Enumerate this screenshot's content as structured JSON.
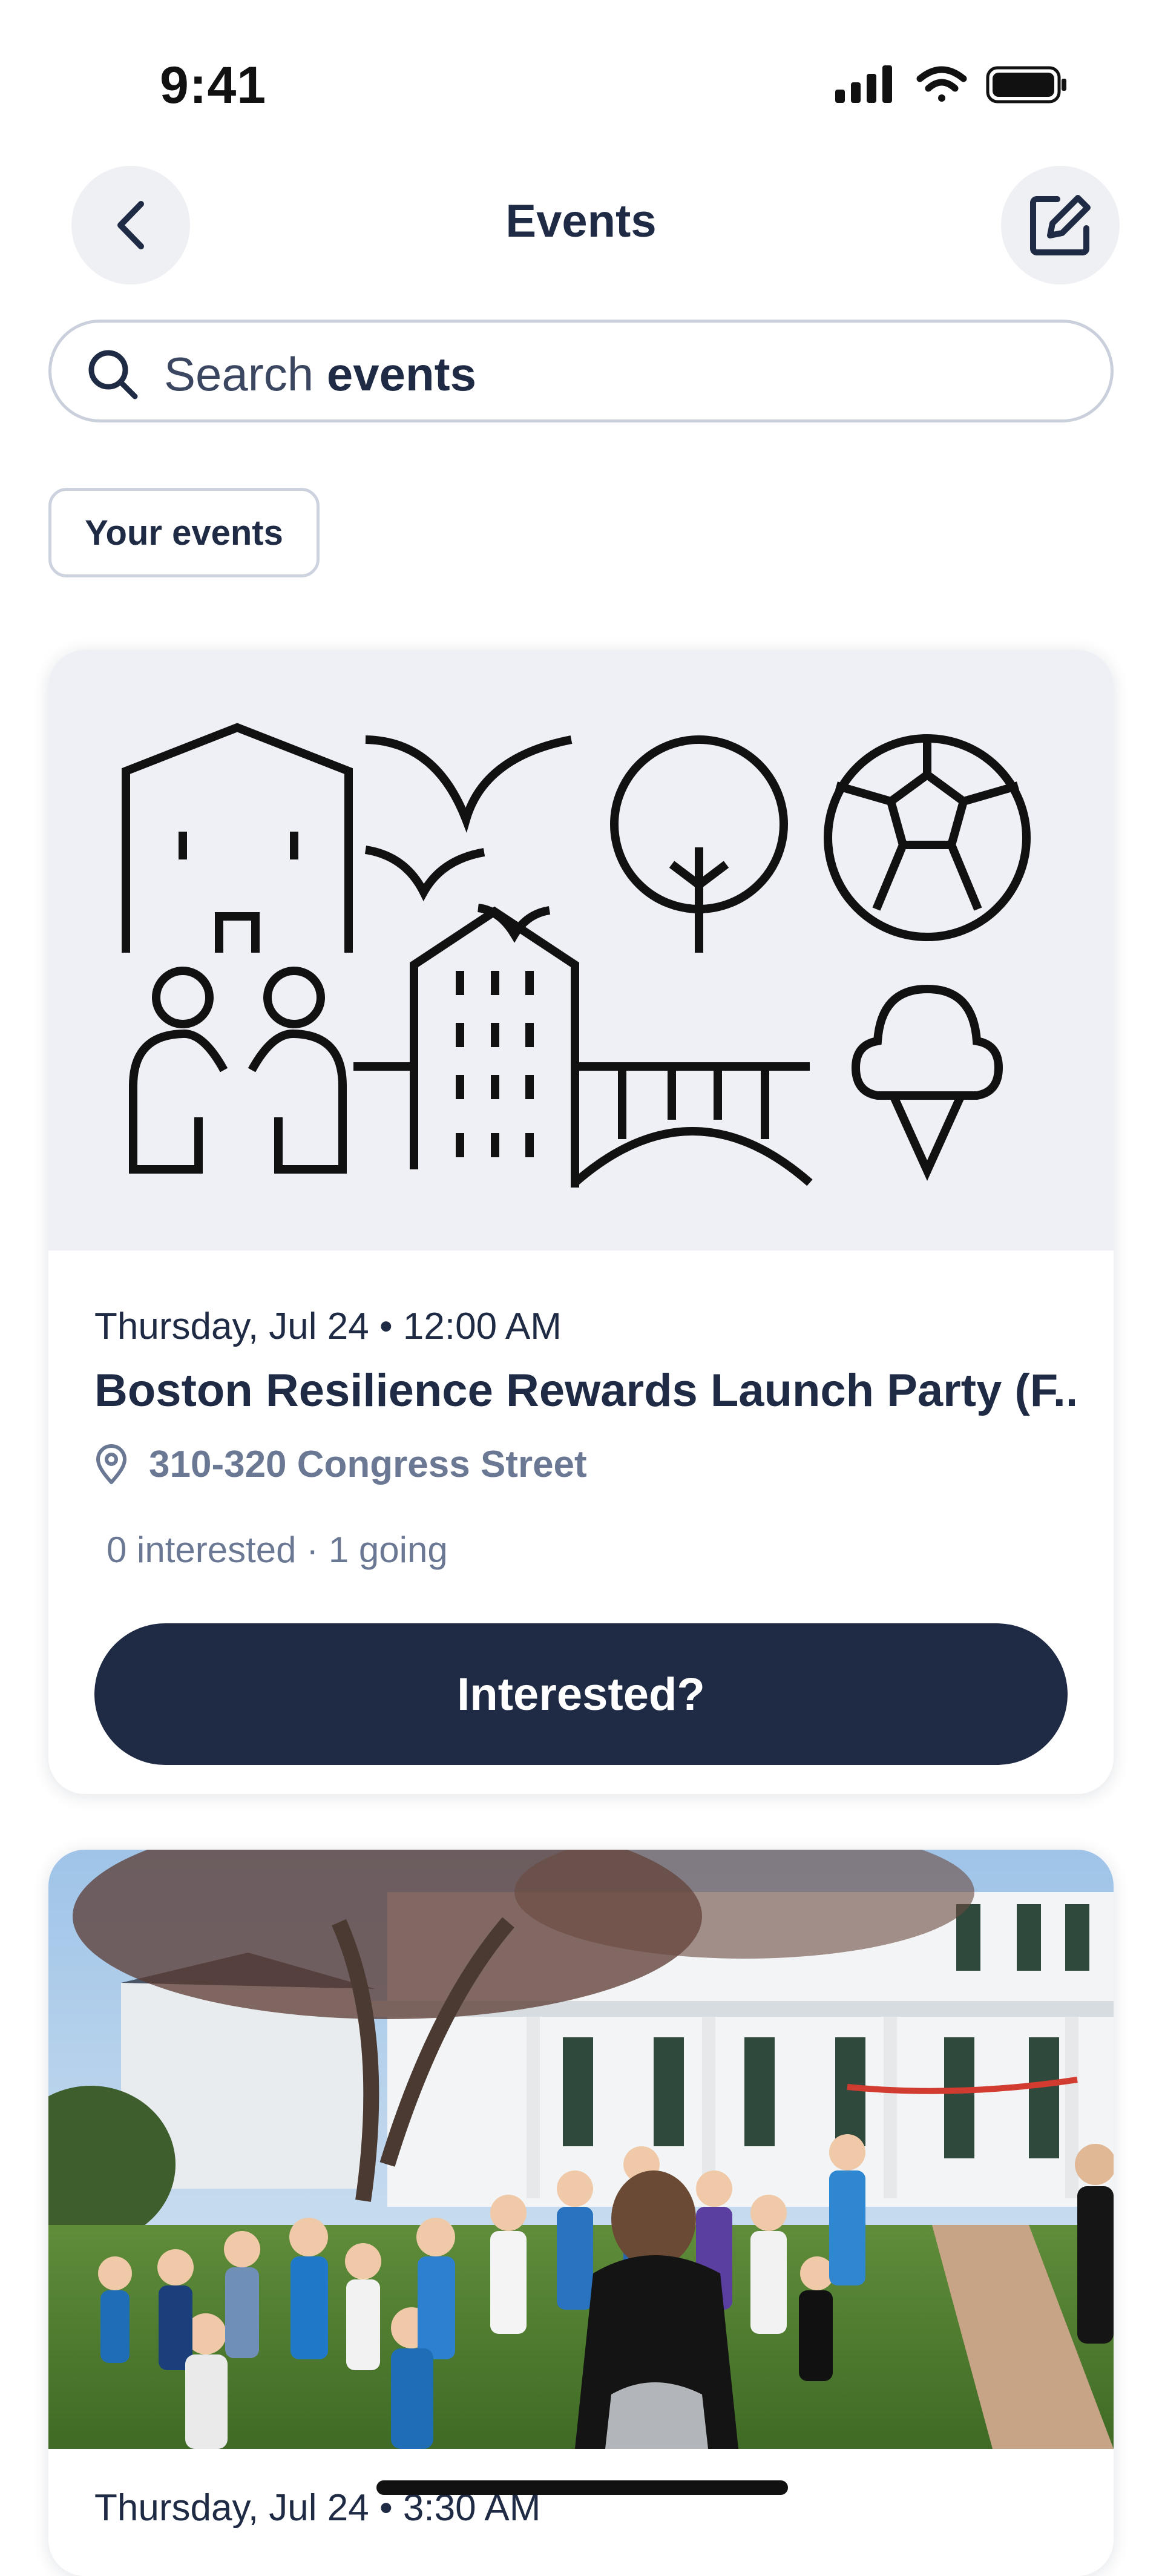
{
  "status_bar": {
    "time": "9:41"
  },
  "header": {
    "title": "Events"
  },
  "search": {
    "prefix": "Search ",
    "keyword": "events"
  },
  "filters": {
    "your_events": "Your events"
  },
  "events": [
    {
      "date_time": "Thursday, Jul 24 • 12:00 AM",
      "title": "Boston Resilience Rewards Launch Party (F...",
      "location": "310-320 Congress Street",
      "counts": "0 interested · 1 going",
      "cta": "Interested?"
    },
    {
      "date_time": "Thursday, Jul 24 • 3:30 AM"
    }
  ],
  "colors": {
    "primary": "#1f2a44",
    "muted": "#6b7894",
    "surface": "#eef0f5"
  }
}
